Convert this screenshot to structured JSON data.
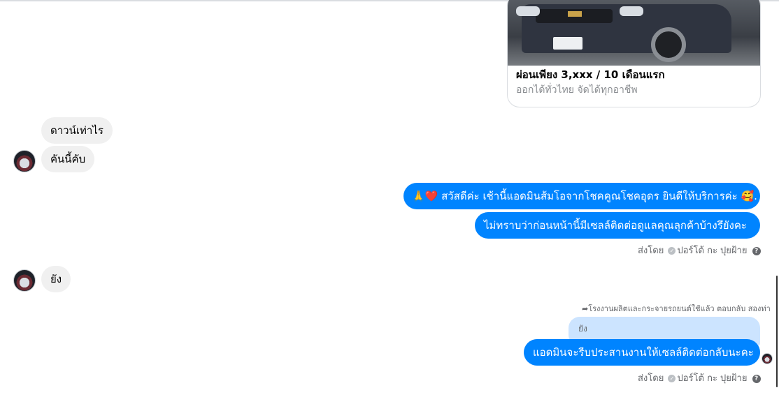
{
  "card": {
    "title": "ผ่อนเพียง 3,xxx / 10 เดือนแรก",
    "subtitle": "ออกได้ทั่วไทย จัดได้ทุกอาชีพ"
  },
  "messages": {
    "in_1": "ดาวน์เท่าไร",
    "in_2": "คันนี้คับ",
    "out_1_emoji": "🙏❤️",
    "out_1": "สวัสดีค่ะ เช้านี้แอดมินส้มโอจากโชคคูณโชคอุดร ยินดีให้บริการค่ะ",
    "out_1_tail": "🥰.",
    "out_2": "ไม่ทราบว่าก่อนหน้านี้มีเซลล์ติดต่อดูแลคุณลุกค้าบ้างรึยังคะ",
    "in_3": "ยัง",
    "reply_context": "โรงงานผลิตและกระจายรถยนต์ใช้แล้ว ตอบกลับ สองท่า",
    "quoted": "ยัง",
    "out_3": "แอดมินจะรีบประสานงานให้เซลล์ติดต่อกลับนะคะ"
  },
  "meta": {
    "sent_by_prefix": "ส่งโดย",
    "sender_name": "ปอร์โต้ กะ ปุยฝ้าย",
    "help_icon": "?",
    "check_icon": "✓",
    "reply_arrow": "➦"
  }
}
